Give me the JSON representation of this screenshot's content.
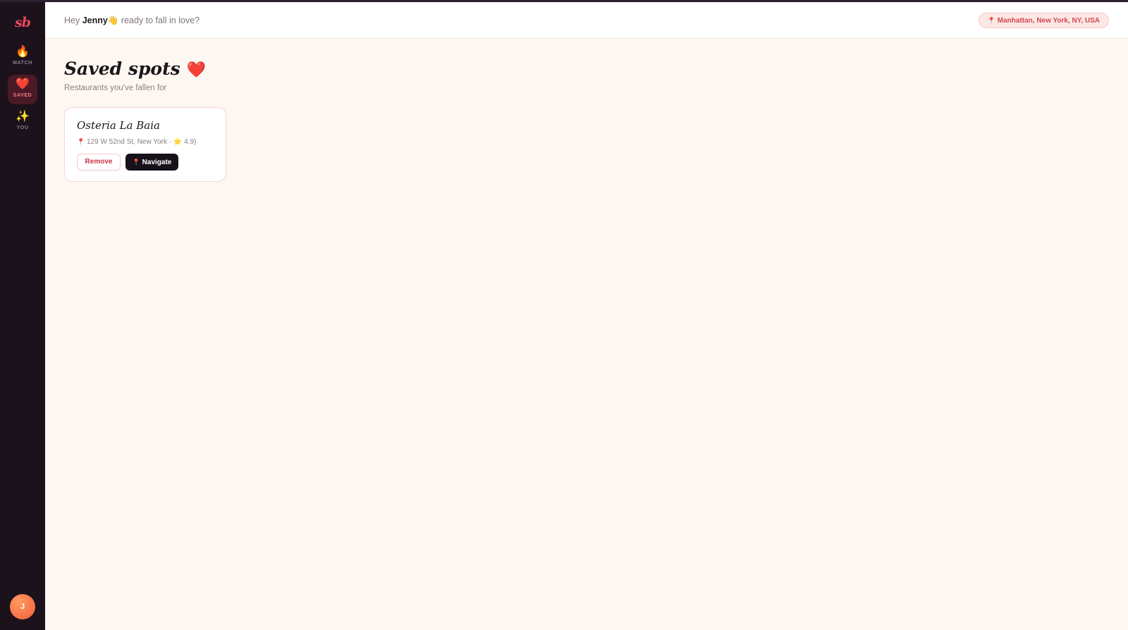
{
  "app": {
    "logo_text": "sb"
  },
  "sidebar": {
    "items": [
      {
        "label": "MATCH",
        "icon": "flame-icon",
        "glyph": "🔥",
        "active": false
      },
      {
        "label": "SAVED",
        "icon": "heart-icon",
        "glyph": "❤️",
        "active": true
      },
      {
        "label": "YOU",
        "icon": "sparkles-icon",
        "glyph": "✨",
        "active": false
      }
    ],
    "avatar_initial": "J"
  },
  "header": {
    "greeting_prefix": "Hey",
    "user_name": "Jenny",
    "wave_emoji": "👋",
    "greeting_suffix": "ready to fall in love?",
    "location_pin": "📍",
    "location": "Manhattan, New York, NY, USA"
  },
  "page": {
    "title": "Saved spots",
    "title_emoji": "❤️",
    "subtitle": "Restaurants you've fallen for"
  },
  "saved": [
    {
      "name": "Osteria La Baia",
      "pin": "📍",
      "address": "129 W 52nd St, New York",
      "separator": "·",
      "star": "⭐",
      "rating": "4.9)",
      "remove_label": "Remove",
      "navigate_pin": "📍",
      "navigate_label": "Navigate"
    }
  ],
  "colors": {
    "sidebar_bg": "#1c121b",
    "accent": "#e9475d",
    "page_bg": "#fdf7f2",
    "button_dark": "#17121a"
  }
}
